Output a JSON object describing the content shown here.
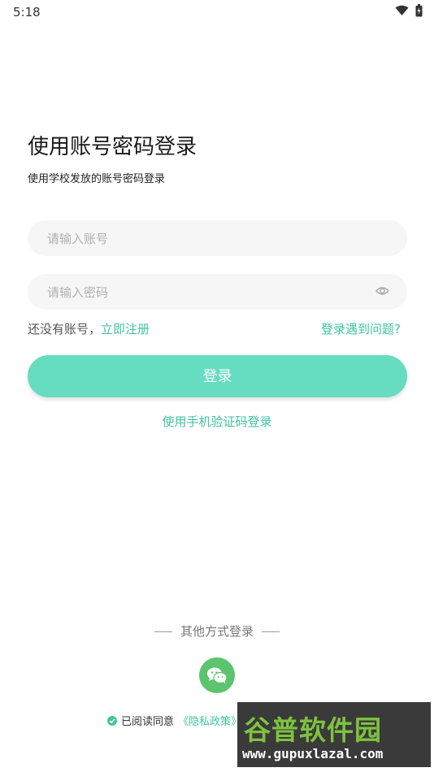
{
  "status_bar": {
    "time": "5:18",
    "wifi_icon": "wifi-icon",
    "battery_icon": "battery-icon"
  },
  "header": {
    "title": "使用账号密码登录",
    "subtitle": "使用学校发放的账号密码登录"
  },
  "form": {
    "account": {
      "placeholder": "请输入账号",
      "value": ""
    },
    "password": {
      "placeholder": "请输入密码",
      "value": "",
      "toggle_icon": "eye-icon"
    }
  },
  "links": {
    "no_account": "还没有账号，",
    "register": "立即注册",
    "problem": "登录遇到问题?"
  },
  "login_button": "登录",
  "sms_login": "使用手机验证码登录",
  "other_login": {
    "label": "其他方式登录",
    "wechat_icon": "wechat-icon"
  },
  "agreement": {
    "text": "已阅读同意",
    "policy": "《隐私政策》",
    "checked": true
  },
  "watermark": {
    "top": "谷普软件园",
    "bottom": "www.gupuxlazal.com"
  },
  "colors": {
    "accent": "#3fc4a1",
    "button": "#66dcc0",
    "wechat": "#5cc46e"
  }
}
